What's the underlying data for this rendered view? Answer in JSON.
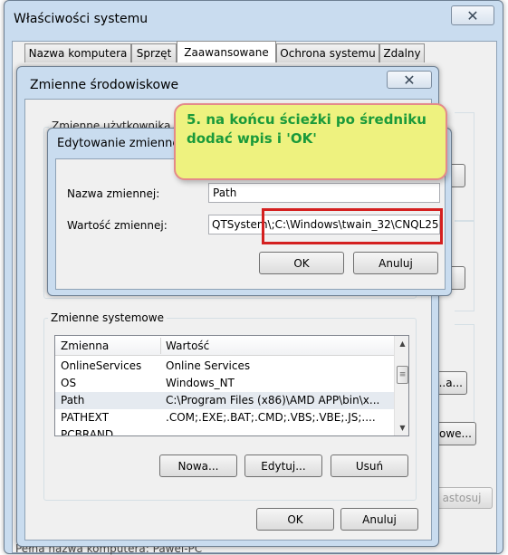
{
  "system_window": {
    "title": "Właściwości systemu",
    "tabs": [
      {
        "label": "Nazwa komputera"
      },
      {
        "label": "Sprzęt"
      },
      {
        "label": "Zaawansowane"
      },
      {
        "label": "Ochrona systemu"
      },
      {
        "label": "Zdalny"
      }
    ],
    "right_buttons": [
      "...a...",
      "owe..."
    ],
    "apply_label": "astosuj",
    "footer_text": "Pełna nazwa komputera:     Pawel-PC"
  },
  "env_window": {
    "title": "Zmienne środowiskowe",
    "user_section_label": "Zmienne użytkownika",
    "system_section_label": "Zmienne systemowe",
    "columns": {
      "name": "Zmienna",
      "value": "Wartość"
    },
    "rows": [
      {
        "name": "OnlineServices",
        "value": "Online Services"
      },
      {
        "name": "OS",
        "value": "Windows_NT"
      },
      {
        "name": "Path",
        "value": "C:\\Program Files (x86)\\AMD APP\\bin\\x..."
      },
      {
        "name": "PATHEXT",
        "value": ".COM;.EXE;.BAT;.CMD;.VBS;.VBE;.JS;...."
      },
      {
        "name": "PCBRAND",
        "value": ""
      }
    ],
    "buttons": {
      "new": "Nowa...",
      "edit": "Edytuj...",
      "delete": "Usuń",
      "ok": "OK",
      "cancel": "Anuluj"
    }
  },
  "edit_dialog": {
    "title": "Edytowanie zmiennej systemowej",
    "name_label": "Nazwa zmiennej:",
    "name_value": "Path",
    "value_label": "Wartość zmiennej:",
    "value_value": "QTSystem\\;C:\\Windows\\twain_32\\CNQL25",
    "ok": "OK",
    "cancel": "Anuluj"
  },
  "callout": {
    "text": "5. na końcu ścieżki po średniku dodać wpis i 'OK'"
  },
  "colors": {
    "callout_bg": "#eef27f",
    "callout_text": "#1a9a3a",
    "callout_border": "#e48a8a",
    "highlight_box": "#d42020"
  }
}
